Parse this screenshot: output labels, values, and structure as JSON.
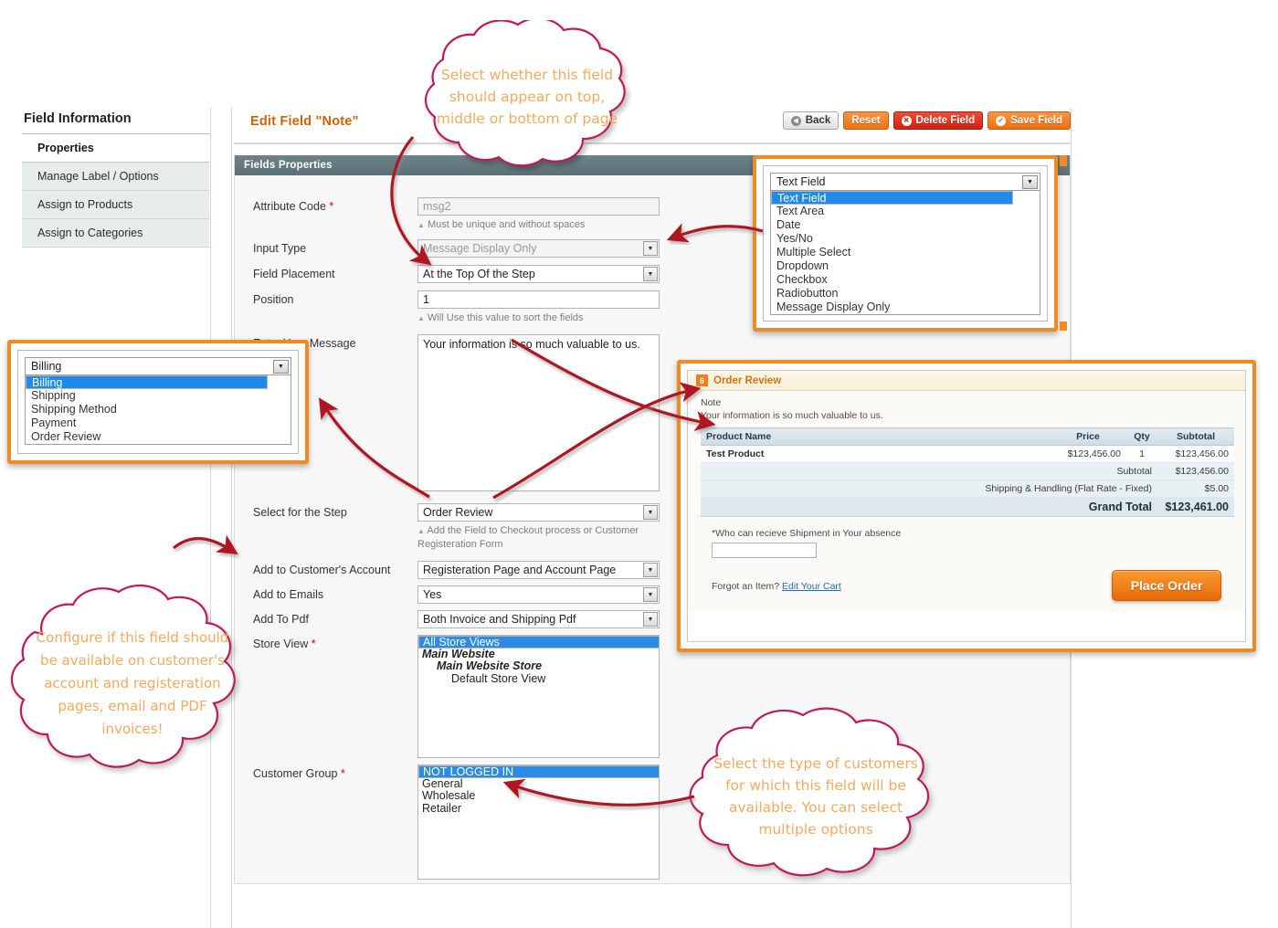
{
  "sidebar": {
    "title": "Field Information",
    "items": [
      {
        "label": "Properties",
        "active": true
      },
      {
        "label": "Manage Label / Options",
        "active": false
      },
      {
        "label": "Assign to Products",
        "active": false
      },
      {
        "label": "Assign to Categories",
        "active": false
      }
    ]
  },
  "header": {
    "page_title": "Edit Field \"Note\"",
    "buttons": [
      {
        "label": "Back",
        "style": "grey",
        "icon": "back-arrow-icon"
      },
      {
        "label": "Reset",
        "style": "orange",
        "icon": ""
      },
      {
        "label": "Delete Field",
        "style": "red",
        "icon": "delete-circle-icon"
      },
      {
        "label": "Save Field",
        "style": "orange2",
        "icon": "check-circle-icon"
      }
    ]
  },
  "form": {
    "panel_title": "Fields Properties",
    "attribute_code": {
      "label": "Attribute Code",
      "required": true,
      "value": "msg2",
      "hint": "Must be unique and without spaces"
    },
    "input_type": {
      "label": "Input Type",
      "value": "Message Display Only"
    },
    "field_placement": {
      "label": "Field Placement",
      "value": "At the Top Of the Step"
    },
    "position": {
      "label": "Position",
      "value": "1",
      "hint": "Will Use this value to sort the fields"
    },
    "message": {
      "label": "Enter Your Message",
      "value": "Your information is so much valuable to us."
    },
    "select_step": {
      "label": "Select for the Step",
      "value": "Order Review",
      "hint": "Add the Field to Checkout process or Customer Registeration Form"
    },
    "customer_account": {
      "label": "Add to Customer's Account",
      "value": "Registeration Page and Account Page"
    },
    "add_to_emails": {
      "label": "Add to Emails",
      "value": "Yes"
    },
    "add_to_pdf": {
      "label": "Add To Pdf",
      "value": "Both Invoice and Shipping Pdf"
    },
    "store_view": {
      "label": "Store View",
      "required": true,
      "options": [
        {
          "label": "All Store Views",
          "selected": true,
          "indent": 0,
          "bold": false
        },
        {
          "label": "Main Website",
          "selected": false,
          "indent": 0,
          "bold": true
        },
        {
          "label": "Main Website Store",
          "selected": false,
          "indent": 1,
          "bold": true
        },
        {
          "label": "Default Store View",
          "selected": false,
          "indent": 2,
          "bold": false
        }
      ]
    },
    "customer_group": {
      "label": "Customer Group",
      "required": true,
      "options": [
        {
          "label": "NOT LOGGED IN",
          "selected": true
        },
        {
          "label": "General",
          "selected": false
        },
        {
          "label": "Wholesale",
          "selected": false
        },
        {
          "label": "Retailer",
          "selected": false
        }
      ]
    }
  },
  "input_type_dropdown": {
    "selected": "Text Field",
    "options": [
      {
        "label": "Text Field",
        "selected": true
      },
      {
        "label": "Text Area",
        "selected": false
      },
      {
        "label": "Date",
        "selected": false
      },
      {
        "label": "Yes/No",
        "selected": false
      },
      {
        "label": "Multiple Select",
        "selected": false
      },
      {
        "label": "Dropdown",
        "selected": false
      },
      {
        "label": "Checkbox",
        "selected": false
      },
      {
        "label": "Radiobutton",
        "selected": false
      },
      {
        "label": "Message Display Only",
        "selected": false
      }
    ]
  },
  "step_dropdown": {
    "selected": "Billing",
    "options": [
      {
        "label": "Billing",
        "selected": true
      },
      {
        "label": "Shipping",
        "selected": false
      },
      {
        "label": "Shipping Method",
        "selected": false
      },
      {
        "label": "Payment",
        "selected": false
      },
      {
        "label": "Order Review",
        "selected": false
      }
    ]
  },
  "order_review": {
    "step_number": "6",
    "title": "Order Review",
    "note_label": "Note",
    "note_text": "Your information is so much valuable to us.",
    "columns": [
      "Product Name",
      "Price",
      "Qty",
      "Subtotal"
    ],
    "rows": [
      {
        "name": "Test Product",
        "price": "$123,456.00",
        "qty": "1",
        "subtotal": "$123,456.00"
      }
    ],
    "totals": [
      {
        "label": "Subtotal",
        "value": "$123,456.00"
      },
      {
        "label": "Shipping & Handling (Flat Rate - Fixed)",
        "value": "$5.00"
      }
    ],
    "grand_total_label": "Grand Total",
    "grand_total_value": "$123,461.00",
    "custom_field_label": "*Who can recieve Shipment in Your absence",
    "custom_field_value": "",
    "forgot_text": "Forgot an Item?",
    "forgot_link": "Edit Your Cart",
    "place_order_label": "Place Order"
  },
  "callouts": {
    "top": "Select whether this field should appear on top, middle or bottom of page",
    "bottom_left": "Configure if this field should be available on customer's account and registeration pages, email and PDF invoices!",
    "bottom_right": "Select the type of customers for which this field will be available. You can select multiple options"
  },
  "colors": {
    "accent_orange": "#f08a24",
    "callout_text": "#f5a95f",
    "callout_border": "#c2185b",
    "arrow_red": "#b01722",
    "select_blue": "#1f8aea",
    "panel_header": "#5c7176",
    "title_orange": "#d95e00"
  }
}
